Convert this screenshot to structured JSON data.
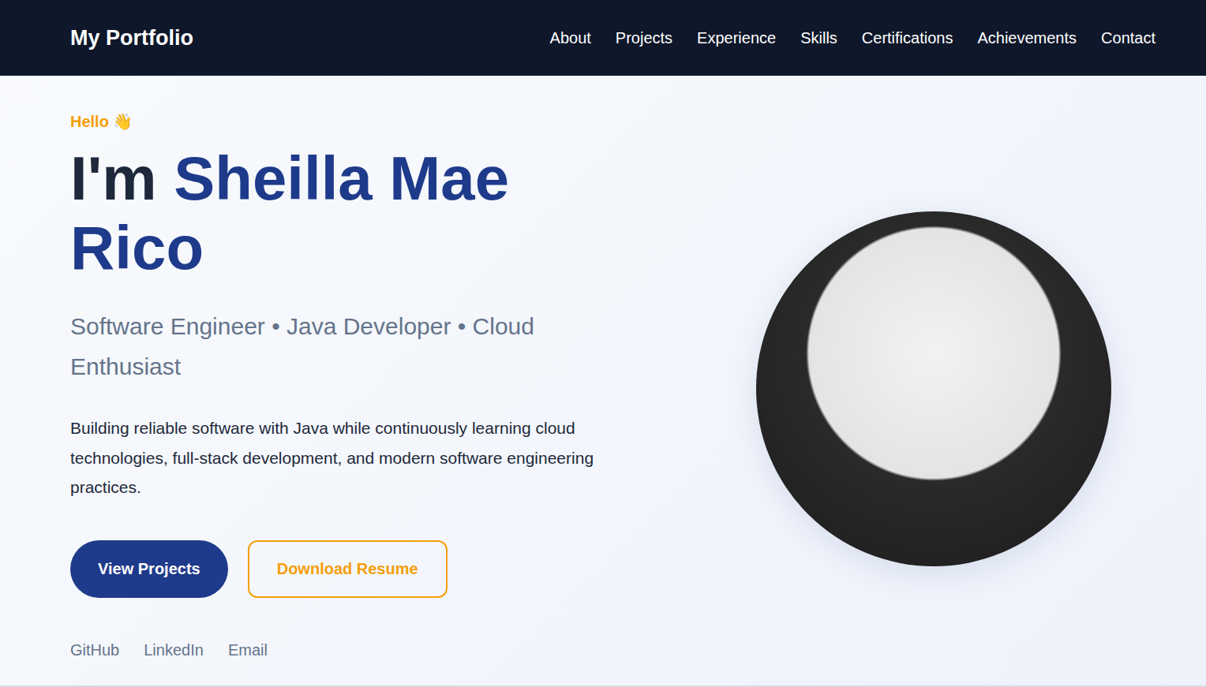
{
  "nav": {
    "logo": "My Portfolio",
    "links": [
      "About",
      "Projects",
      "Experience",
      "Skills",
      "Certifications",
      "Achievements",
      "Contact"
    ]
  },
  "hero": {
    "greeting": "Hello 👋",
    "heading_prefix": "I'm",
    "name": "Sheilla Mae Rico",
    "subtitle": "Software Engineer • Java Developer • Cloud Enthusiast",
    "description": "Building reliable software with Java while continuously learning cloud technologies, full-stack development, and modern software engineering practices.",
    "buttons": [
      {
        "label": "View Projects",
        "kind": "primary"
      },
      {
        "label": "Download Resume",
        "kind": "outline"
      }
    ],
    "social": [
      "GitHub",
      "LinkedIn",
      "Email"
    ]
  }
}
